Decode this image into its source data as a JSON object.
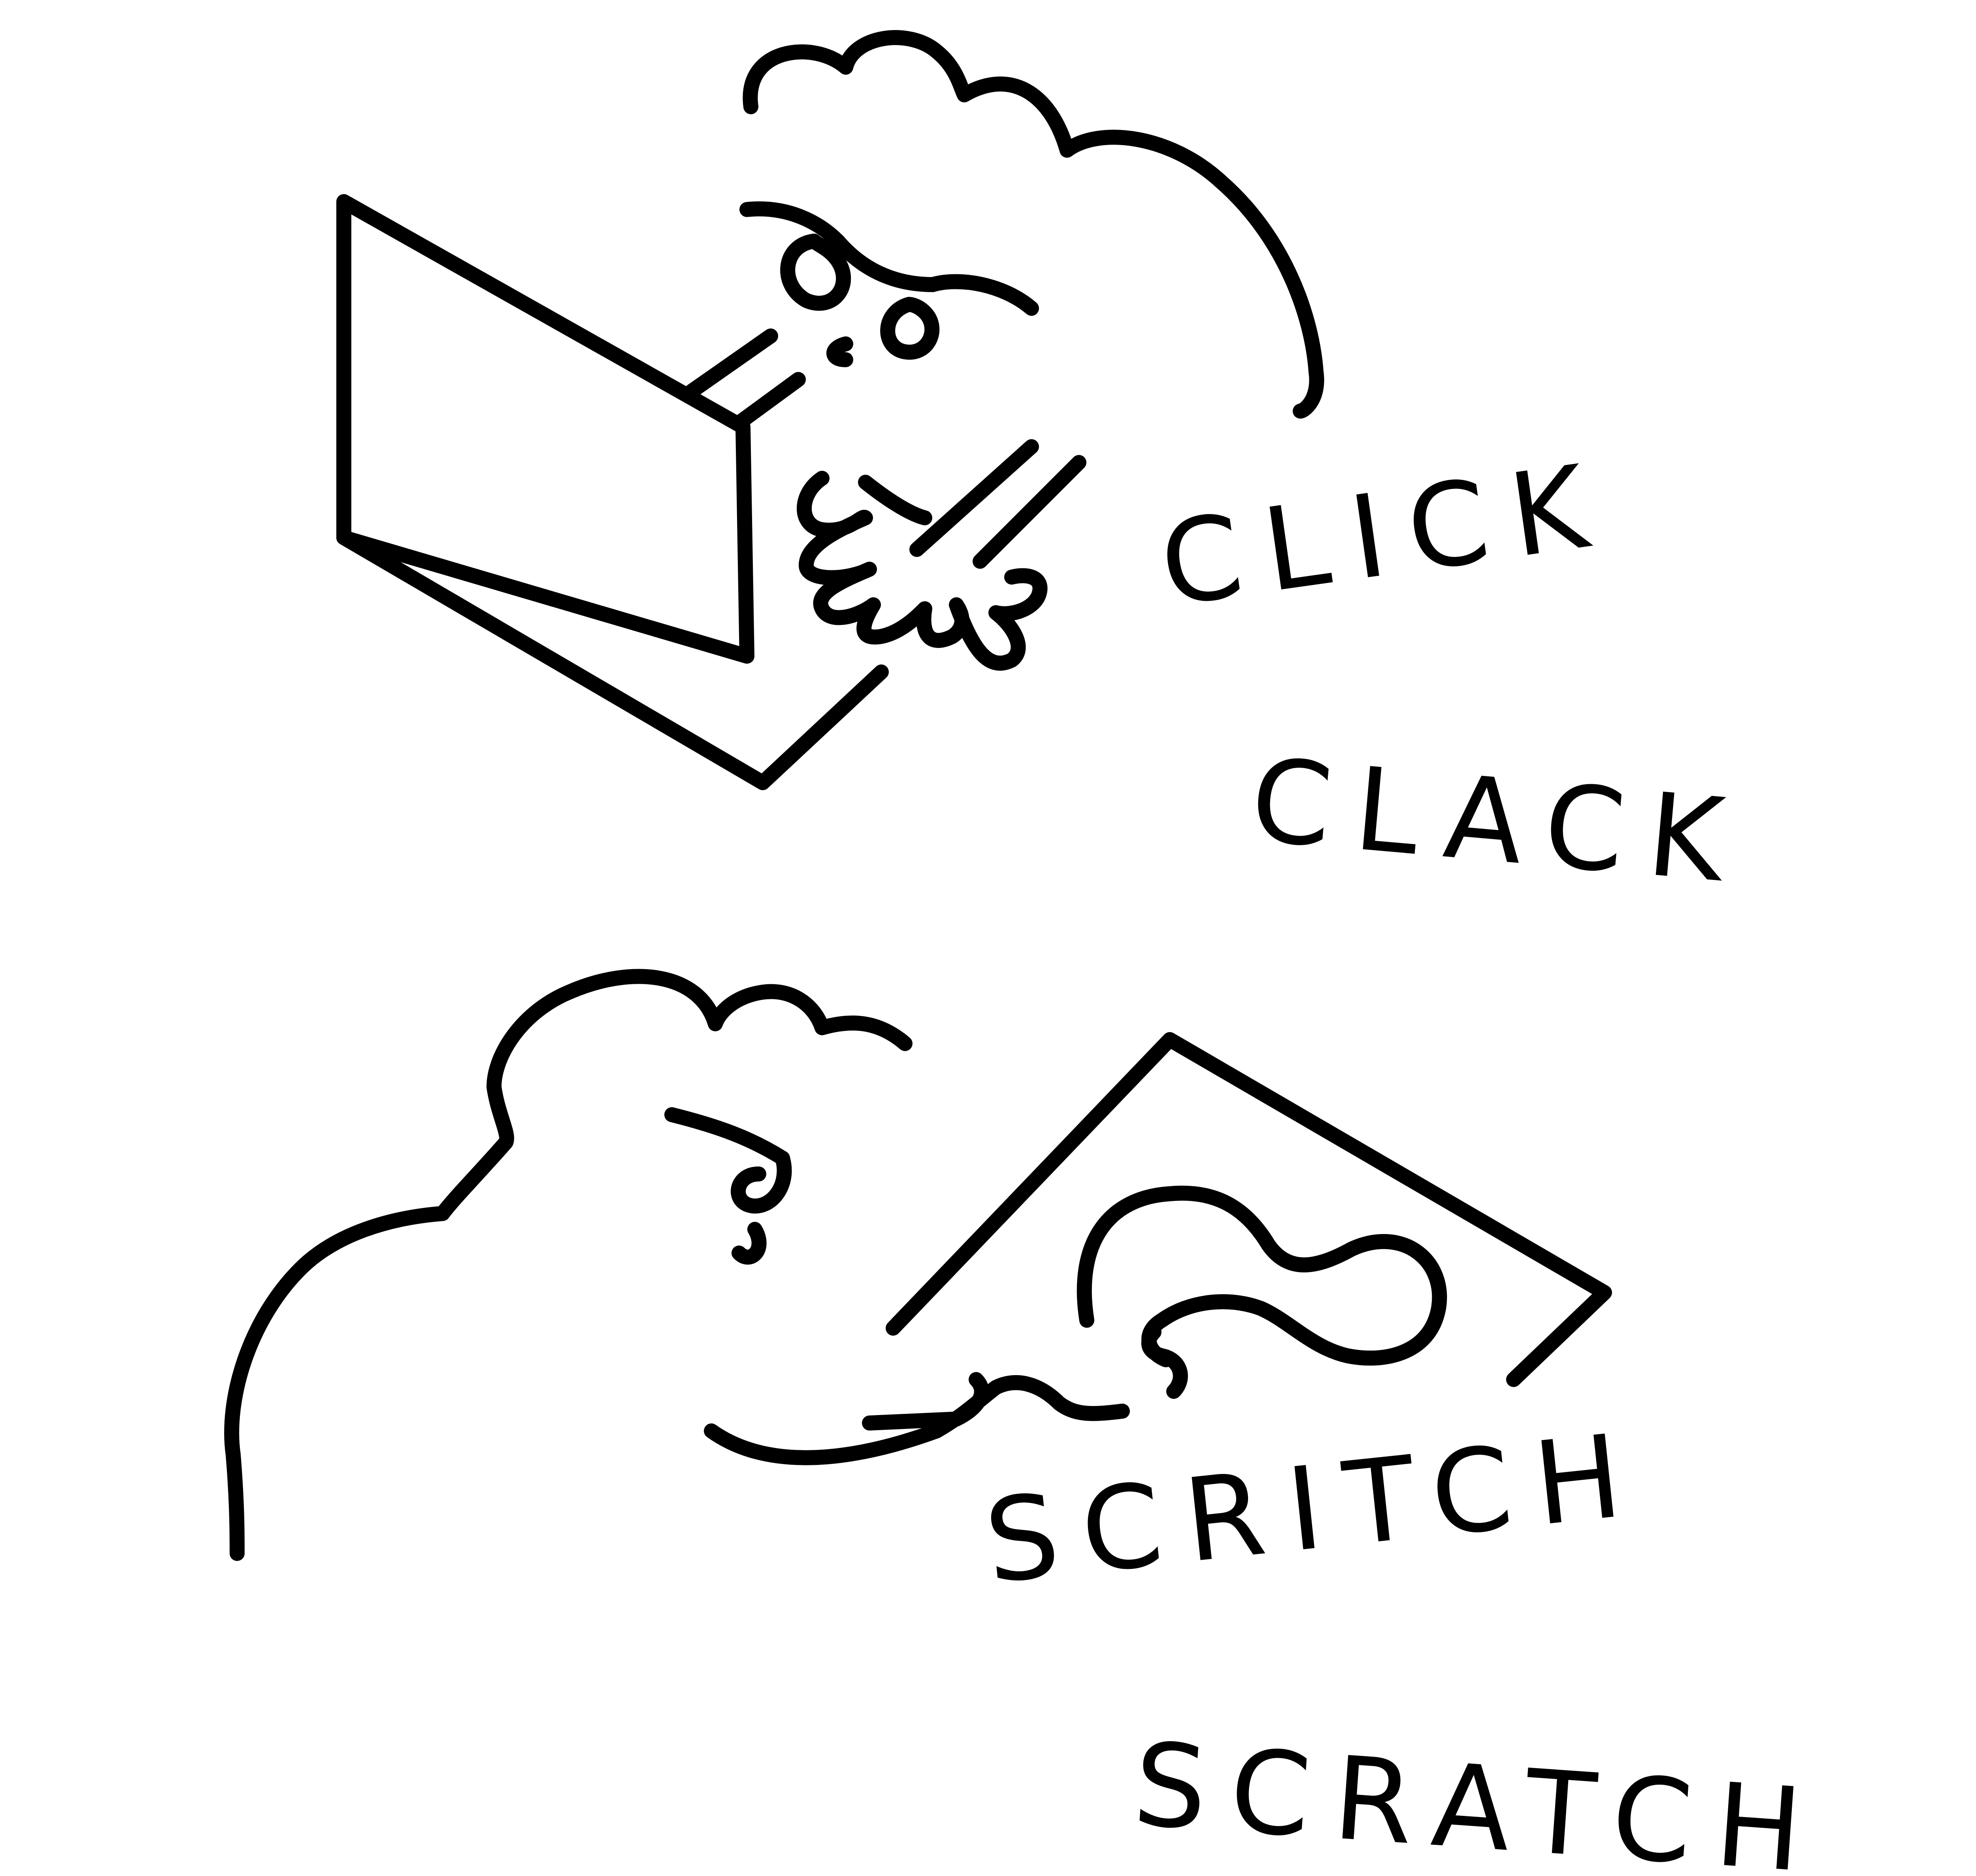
{
  "drawing": {
    "upper_scene": {
      "sound_line_1": "CLICK",
      "sound_line_2": "CLACK"
    },
    "lower_scene": {
      "sound_line_1": "SCRITCH",
      "sound_line_2": "SCRATCH"
    }
  },
  "colors": {
    "ink": "#000000",
    "paper": "#ffffff"
  }
}
